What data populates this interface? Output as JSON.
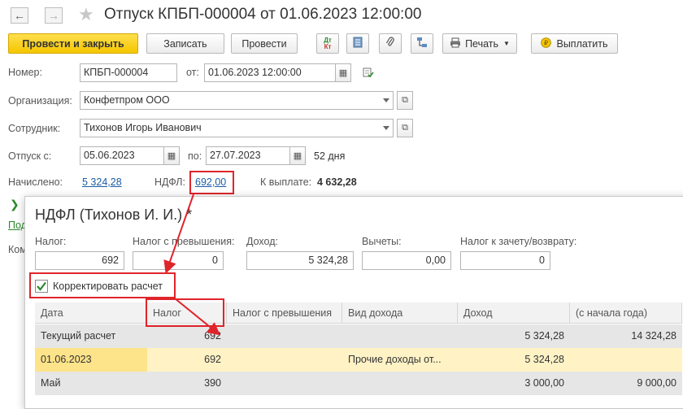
{
  "window": {
    "title": "Отпуск КПБП-000004 от 01.06.2023 12:00:00"
  },
  "icons": {
    "back": "arrow-left-icon",
    "forward": "arrow-right-icon",
    "favorite": "star-icon",
    "dtkt": "dt-kt-icon",
    "journal": "journal-icon",
    "attach": "paperclip-icon",
    "structure": "structure-icon",
    "print": "printer-icon",
    "pay": "coin-icon"
  },
  "toolbar": {
    "post_close": "Провести и закрыть",
    "save": "Записать",
    "post": "Провести",
    "dtkt_top": "Дт",
    "dtkt_bottom": "Кт",
    "print": "Печать",
    "pay": "Выплатить"
  },
  "form": {
    "number_label": "Номер:",
    "number_value": "КПБП-000004",
    "from_label": "от:",
    "date_value": "01.06.2023 12:00:00",
    "org_label": "Организация:",
    "org_value": "Конфетпром ООО",
    "employee_label": "Сотрудник:",
    "employee_value": "Тихонов Игорь Иванович",
    "vacation_label": "Отпуск с:",
    "vacation_from": "05.06.2023",
    "to_label": "по:",
    "vacation_to": "27.07.2023",
    "days": "52 дня",
    "accrued_label": "Начислено:",
    "accrued_value": "5 324,28",
    "ndfl_label": "НДФЛ:",
    "ndfl_value": "692,00",
    "payout_label": "К выплате:",
    "payout_value": "4 632,28",
    "hidden_link_fragment": "Под",
    "hidden_label_fragment": "Ком"
  },
  "popup": {
    "title": "НДФЛ (Тихонов И. И.) *",
    "fields": {
      "tax_label": "Налог:",
      "tax_value": "692",
      "tax_excess_label": "Налог с превышения:",
      "tax_excess_value": "0",
      "income_label": "Доход:",
      "income_value": "5 324,28",
      "deductions_label": "Вычеты:",
      "deductions_value": "0,00",
      "offset_label": "Налог к зачету/возврату:",
      "offset_value": "0"
    },
    "correct_checkbox": {
      "label": "Корректировать расчет",
      "checked": true
    },
    "table": {
      "columns": [
        "Дата",
        "Налог",
        "Налог с превышения",
        "Вид дохода",
        "Доход",
        "(с начала года)"
      ],
      "rows": [
        [
          "Текущий расчет",
          "692",
          "",
          "",
          "5 324,28",
          "14 324,28"
        ],
        [
          "01.06.2023",
          "692",
          "",
          "Прочие доходы от...",
          "5 324,28",
          ""
        ],
        [
          "Май",
          "390",
          "",
          "",
          "3 000,00",
          "9 000,00"
        ]
      ]
    }
  },
  "colors": {
    "primary_button": "#f5c500",
    "highlight_red": "#e0242b",
    "link": "#1a5da8",
    "selected_row": "#fff3c6",
    "group_row": "#e6e6e6"
  }
}
